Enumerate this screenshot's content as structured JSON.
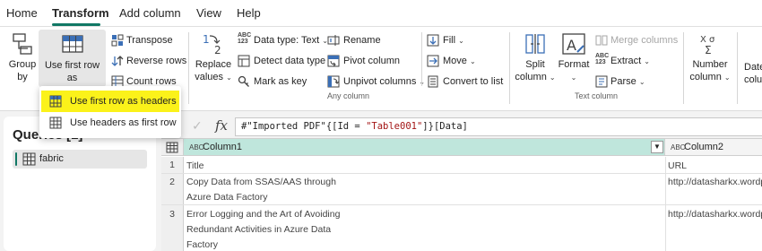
{
  "menu": {
    "tabs": [
      "Home",
      "Transform",
      "Add column",
      "View",
      "Help"
    ]
  },
  "ribbon": {
    "group_by": [
      "Group",
      "by"
    ],
    "use_first_row": [
      "Use first row as",
      "headers"
    ],
    "transpose": "Transpose",
    "reverse_rows": "Reverse rows",
    "count_rows": "Count rows",
    "replace_values": [
      "Replace",
      "values"
    ],
    "data_type": "Data type: Text",
    "detect_data_type": "Detect data type",
    "mark_as_key": "Mark as key",
    "rename": "Rename",
    "pivot_column": "Pivot column",
    "unpivot_columns": "Unpivot columns",
    "fill": "Fill",
    "move": "Move",
    "convert_to_list": "Convert to list",
    "any_column_label": "Any column",
    "split_column": [
      "Split",
      "column"
    ],
    "format": "Format",
    "merge_columns": "Merge columns",
    "extract": "Extract",
    "parse": "Parse",
    "text_column_label": "Text column",
    "number_column": [
      "Number",
      "column"
    ],
    "date_partial": [
      "Date",
      "colu"
    ],
    "abc123": [
      "ABC",
      "123"
    ]
  },
  "dropdown": {
    "items": [
      "Use first row as headers",
      "Use headers as first row"
    ]
  },
  "queries": {
    "title": "Queries",
    "count": "[1]",
    "item": "fabric"
  },
  "formula": {
    "fx": "fx",
    "prefix": "#\"Imported PDF\"{[Id = ",
    "string": "\"Table001\"",
    "suffix": "]}[Data]"
  },
  "grid": {
    "type_icon": "ABC",
    "columns": [
      "Column1",
      "Column2"
    ],
    "rows": [
      {
        "num": "1",
        "c1": [
          "Title"
        ],
        "c2": "URL"
      },
      {
        "num": "2",
        "c1": [
          "Copy Data from SSAS/AAS through",
          "Azure Data Factory"
        ],
        "c2": "http://datasharkx.wordpre"
      },
      {
        "num": "3",
        "c1": [
          "Error Logging and the Art of Avoiding",
          "Redundant Activities in Azure Data",
          "Factory"
        ],
        "c2": "http://datasharkx.wordpre"
      }
    ]
  },
  "colors": {
    "accent": "#117865",
    "highlight": "#fbf21a",
    "string": "#a31515"
  }
}
